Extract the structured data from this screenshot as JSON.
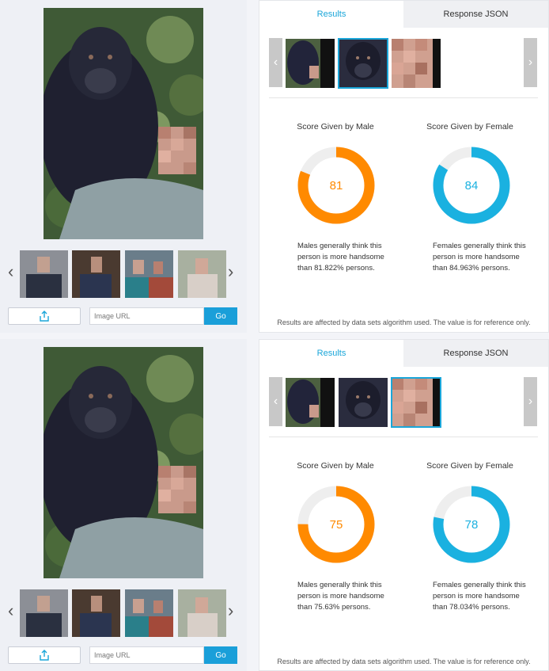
{
  "panels": [
    {
      "tabs": {
        "results": "Results",
        "response_json": "Response JSON"
      },
      "url_placeholder": "Image URL",
      "go_label": "Go",
      "selected_face": 1,
      "male": {
        "title": "Score Given by Male",
        "score": 81,
        "description": "Males generally think this person is more handsome than 81.822% persons."
      },
      "female": {
        "title": "Score Given by Female",
        "score": 84,
        "description": "Females generally think this person is more handsome than 84.963% persons."
      },
      "note": "Results are affected by data sets algorithm used. The value is for reference only."
    },
    {
      "tabs": {
        "results": "Results",
        "response_json": "Response JSON"
      },
      "url_placeholder": "Image URL",
      "go_label": "Go",
      "selected_face": 2,
      "male": {
        "title": "Score Given by Male",
        "score": 75,
        "description": "Males generally think this person is more handsome than 75.63% persons."
      },
      "female": {
        "title": "Score Given by Female",
        "score": 78,
        "description": "Females generally think this person is more handsome than 78.034% persons."
      },
      "note": "Results are affected by data sets algorithm used. The value is for reference only."
    }
  ],
  "colors": {
    "accent": "#1aa6d9",
    "male": "#ff8a00",
    "female": "#1ab1e0",
    "track": "#eeeeee"
  },
  "icons": {
    "upload": "upload-icon",
    "prev": "chevron-left-icon",
    "next": "chevron-right-icon"
  }
}
